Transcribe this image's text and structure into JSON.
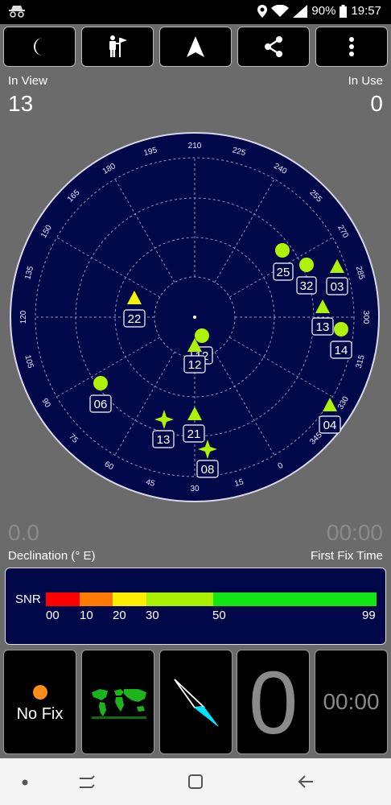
{
  "status_bar": {
    "battery": "90%",
    "time": "19:57",
    "icons": [
      "incognito-icon",
      "location-icon",
      "wifi-icon",
      "signal-icon",
      "battery-icon"
    ]
  },
  "toolbar": {
    "buttons": [
      "night-mode-icon",
      "man-flag-icon",
      "navigation-arrow-icon",
      "share-icon",
      "more-vert-icon"
    ]
  },
  "in_view": {
    "label": "In View",
    "value": "13"
  },
  "in_use": {
    "label": "In Use",
    "value": "0"
  },
  "declination": {
    "value": "0.0",
    "label": "Declination (° E)"
  },
  "first_fix": {
    "value": "00:00",
    "label": "First Fix Time"
  },
  "sky_plot": {
    "azimuth_labels": [
      "0",
      "15",
      "30",
      "45",
      "60",
      "75",
      "90",
      "105",
      "120",
      "135",
      "150",
      "165",
      "180",
      "195",
      "210",
      "225",
      "240",
      "255",
      "270",
      "285",
      "300",
      "315",
      "330",
      "345"
    ],
    "satellites": [
      {
        "id": "25",
        "shape": "circle",
        "color": "#aef20a"
      },
      {
        "id": "32",
        "shape": "circle",
        "color": "#aef20a"
      },
      {
        "id": "03",
        "shape": "triangle",
        "color": "#aef20a"
      },
      {
        "id": "13",
        "shape": "triangle",
        "color": "#aef20a"
      },
      {
        "id": "14",
        "shape": "circle",
        "color": "#aef20a"
      },
      {
        "id": "22",
        "shape": "triangle",
        "color": "#f2f20a"
      },
      {
        "id": "12",
        "shape": "circle",
        "color": "#aef20a"
      },
      {
        "id": "12",
        "shape": "triangle",
        "color": "#aef20a"
      },
      {
        "id": "06",
        "shape": "circle",
        "color": "#aef20a"
      },
      {
        "id": "13",
        "shape": "star",
        "color": "#aef20a"
      },
      {
        "id": "21",
        "shape": "triangle",
        "color": "#aef20a"
      },
      {
        "id": "08",
        "shape": "star",
        "color": "#aef20a"
      },
      {
        "id": "04",
        "shape": "triangle",
        "color": "#aef20a"
      }
    ]
  },
  "snr_legend": {
    "title": "SNR",
    "ticks": [
      "00",
      "10",
      "20",
      "30",
      "50",
      "99"
    ],
    "colors": [
      "#ff0000",
      "#ff7a00",
      "#ffee00",
      "#c8f000",
      "#a8f000",
      "#14e514"
    ]
  },
  "tiles": {
    "fix_status": "No Fix",
    "fix_dot_color": "#ff8c1a",
    "satellites_used": "0",
    "time": "00:00"
  },
  "nav_bar": {
    "buttons": [
      "dot-icon",
      "recent-apps-icon",
      "home-icon",
      "back-icon"
    ]
  }
}
